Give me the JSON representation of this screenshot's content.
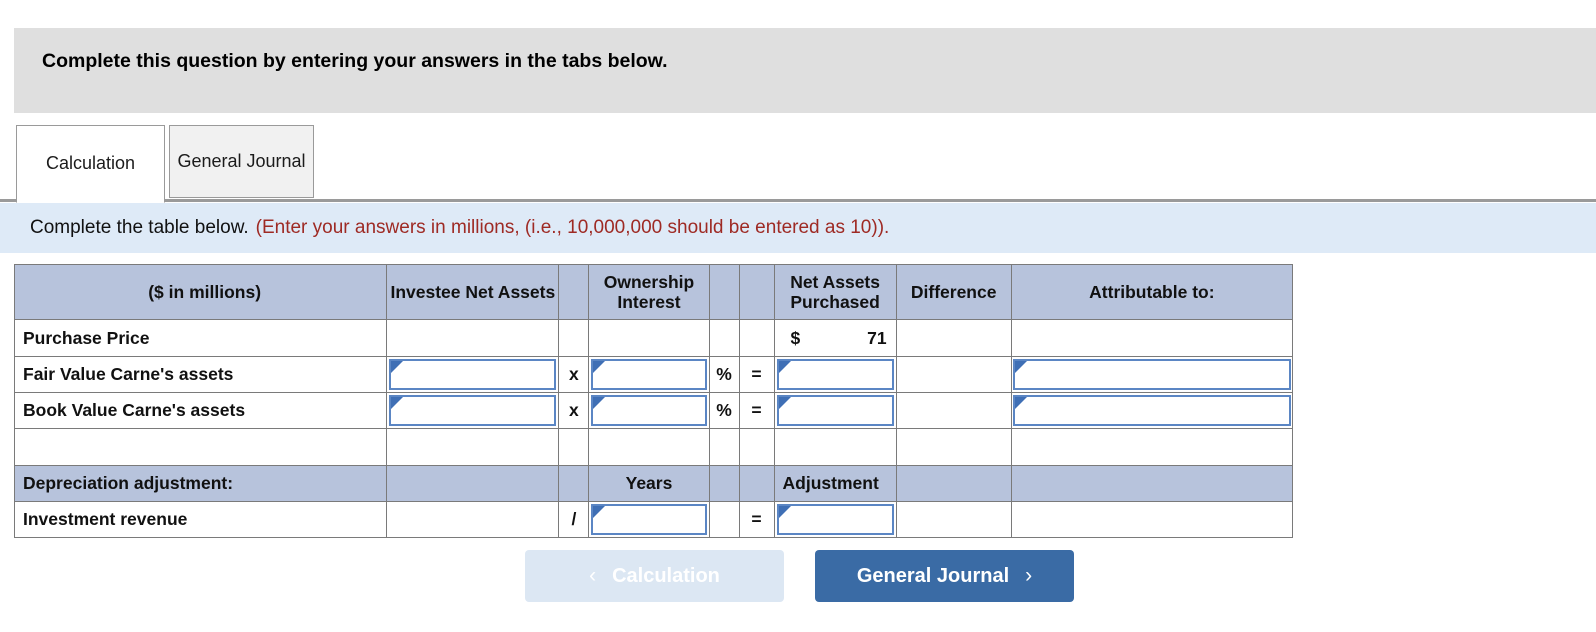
{
  "banner": {
    "text": "Complete this question by entering your answers in the tabs below."
  },
  "tabs": [
    {
      "label": "Calculation",
      "state": "active"
    },
    {
      "label": "General Journal",
      "state": "inactive"
    }
  ],
  "instruction": {
    "main": "Complete the table below.",
    "note": "(Enter your answers in millions, (i.e., 10,000,000 should be entered as 10))."
  },
  "table": {
    "headers": {
      "units": "($ in millions)",
      "investee_net_assets": "Investee Net Assets",
      "spacer_mult": "",
      "ownership_interest": "Ownership Interest",
      "pct": "",
      "eq": "",
      "net_assets_purchased": "Net Assets Purchased",
      "difference": "Difference",
      "attributable_to": "Attributable to:"
    },
    "rows": [
      {
        "label": "Purchase Price",
        "investee_net_assets": "",
        "op1": "",
        "ownership_interest": "",
        "pct": "",
        "eq": "",
        "net_assets_currency": "$",
        "net_assets_value": "71",
        "difference": "",
        "attributable_to": ""
      },
      {
        "label": "Fair Value Carne's assets",
        "investee_net_assets": "",
        "op1": "x",
        "ownership_interest": "",
        "pct": "%",
        "eq": "=",
        "net_assets_purchased": "",
        "difference": "",
        "attributable_to": ""
      },
      {
        "label": "Book Value Carne's assets",
        "investee_net_assets": "",
        "op1": "x",
        "ownership_interest": "",
        "pct": "%",
        "eq": "=",
        "net_assets_purchased": "",
        "difference": "",
        "attributable_to": ""
      },
      {
        "label": "",
        "investee_net_assets": "",
        "op1": "",
        "ownership_interest": "",
        "pct": "",
        "eq": "",
        "net_assets_purchased": "",
        "difference": "",
        "attributable_to": ""
      },
      {
        "label": "Depreciation adjustment:",
        "investee_net_assets": "",
        "op1": "",
        "years_header": "Years",
        "pct": "",
        "eq": "",
        "adjustment_header": "Adjustment",
        "difference": "",
        "attributable_to": ""
      },
      {
        "label": "Investment revenue",
        "investee_net_assets": "",
        "op1": "/",
        "years": "",
        "pct": "",
        "eq": "=",
        "adjustment": "",
        "difference": "",
        "attributable_to": ""
      }
    ]
  },
  "nav": {
    "prev_label": "Calculation",
    "prev_chevron": "‹",
    "next_label": "General Journal",
    "next_chevron": "›"
  },
  "colors": {
    "banner_grey": "#dfdfdf",
    "instruction_blue": "#deeaf7",
    "note_red": "#9e2a24",
    "table_header_blue": "#b7c3dc",
    "input_border_blue": "#5b86c4",
    "primary_button_blue": "#3a6ba5",
    "disabled_button_blue": "#dce7f3"
  }
}
